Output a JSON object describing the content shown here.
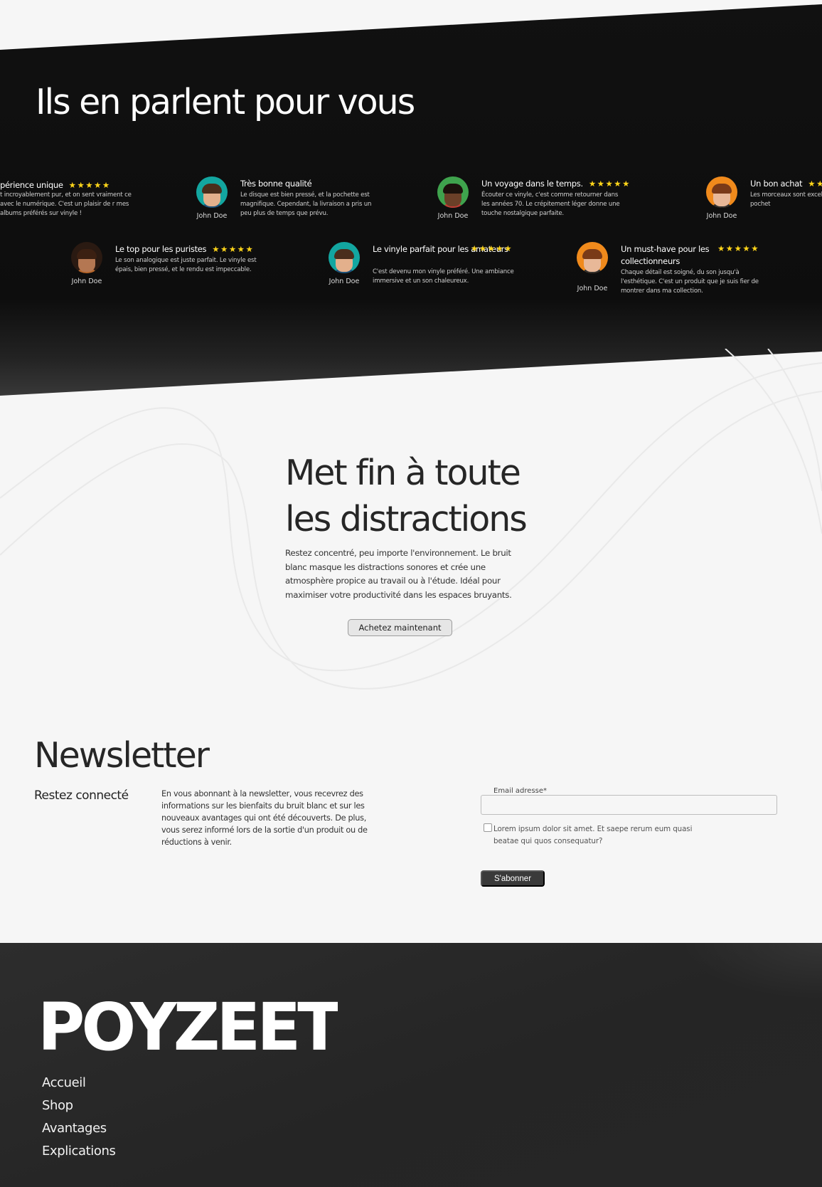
{
  "testimonials": {
    "title": "Ils en parlent pour vous",
    "stars": "★★★★★",
    "reviews": [
      {
        "title": "périence unique",
        "text": "t incroyablement pur, et on sent vraiment ce avec le numérique. C'est un plaisir de r mes albums préférés sur vinyle !",
        "author": ""
      },
      {
        "title": "Très bonne qualité",
        "text": "Le disque est bien pressé, et la pochette est magnifique. Cependant, la livraison a pris un peu plus de temps que prévu.",
        "author": "John Doe"
      },
      {
        "title": "Un voyage dans le temps.",
        "text": "Écouter ce vinyle, c'est comme retourner dans les années 70. Le crépitement léger donne une touche nostalgique parfaite.",
        "author": "John Doe"
      },
      {
        "title": "Un bon achat",
        "text": "Les morceaux sont excelle d'impression de la pochet",
        "author": "John Doe"
      },
      {
        "title": "Le top pour les puristes",
        "text": "Le son analogique est juste parfait. Le vinyle est épais, bien pressé, et le rendu est impeccable.",
        "author": "John Doe"
      },
      {
        "title": "Le vinyle parfait pour les amateurs",
        "text": "C'est devenu mon vinyle préféré. Une ambiance immersive et un son chaleureux.",
        "author": "John Doe"
      },
      {
        "title": "Un must-have pour les collectionneurs",
        "text": "Chaque détail est soigné, du son jusqu'à l'esthétique. C'est un produit que je suis fier de montrer dans ma collection.",
        "author": "John Doe"
      }
    ]
  },
  "hero": {
    "title_line1": "Met fin à toute",
    "title_line2": "les distractions",
    "text": "Restez concentré, peu importe l'environnement. Le bruit blanc masque les distractions sonores et crée une atmosphère propice au travail ou à l'étude. Idéal pour maximiser votre productivité dans les espaces bruyants.",
    "button": "Achetez maintenant"
  },
  "newsletter": {
    "title": "Newsletter",
    "subtitle": "Restez connecté",
    "text": "En vous abonnant à la newsletter, vous recevrez des informations sur les bienfaits du bruit blanc et sur les nouveaux avantages qui ont été découverts. De plus, vous serez informé lors de la sortie d'un produit ou de réductions à venir.",
    "email_label": "Email adresse*",
    "email_value": "",
    "checkbox_label": "Lorem ipsum dolor sit amet. Et saepe rerum eum quasi beatae qui quos consequatur?",
    "submit": "S'abonner"
  },
  "footer": {
    "logo": "POYZEET",
    "nav": [
      "Accueil",
      "Shop",
      "Avantages",
      "Explications"
    ]
  },
  "colors": {
    "star": "#ffd51a",
    "dark": "#0f0f0f",
    "footer": "#262626",
    "background": "#f6f6f6"
  }
}
